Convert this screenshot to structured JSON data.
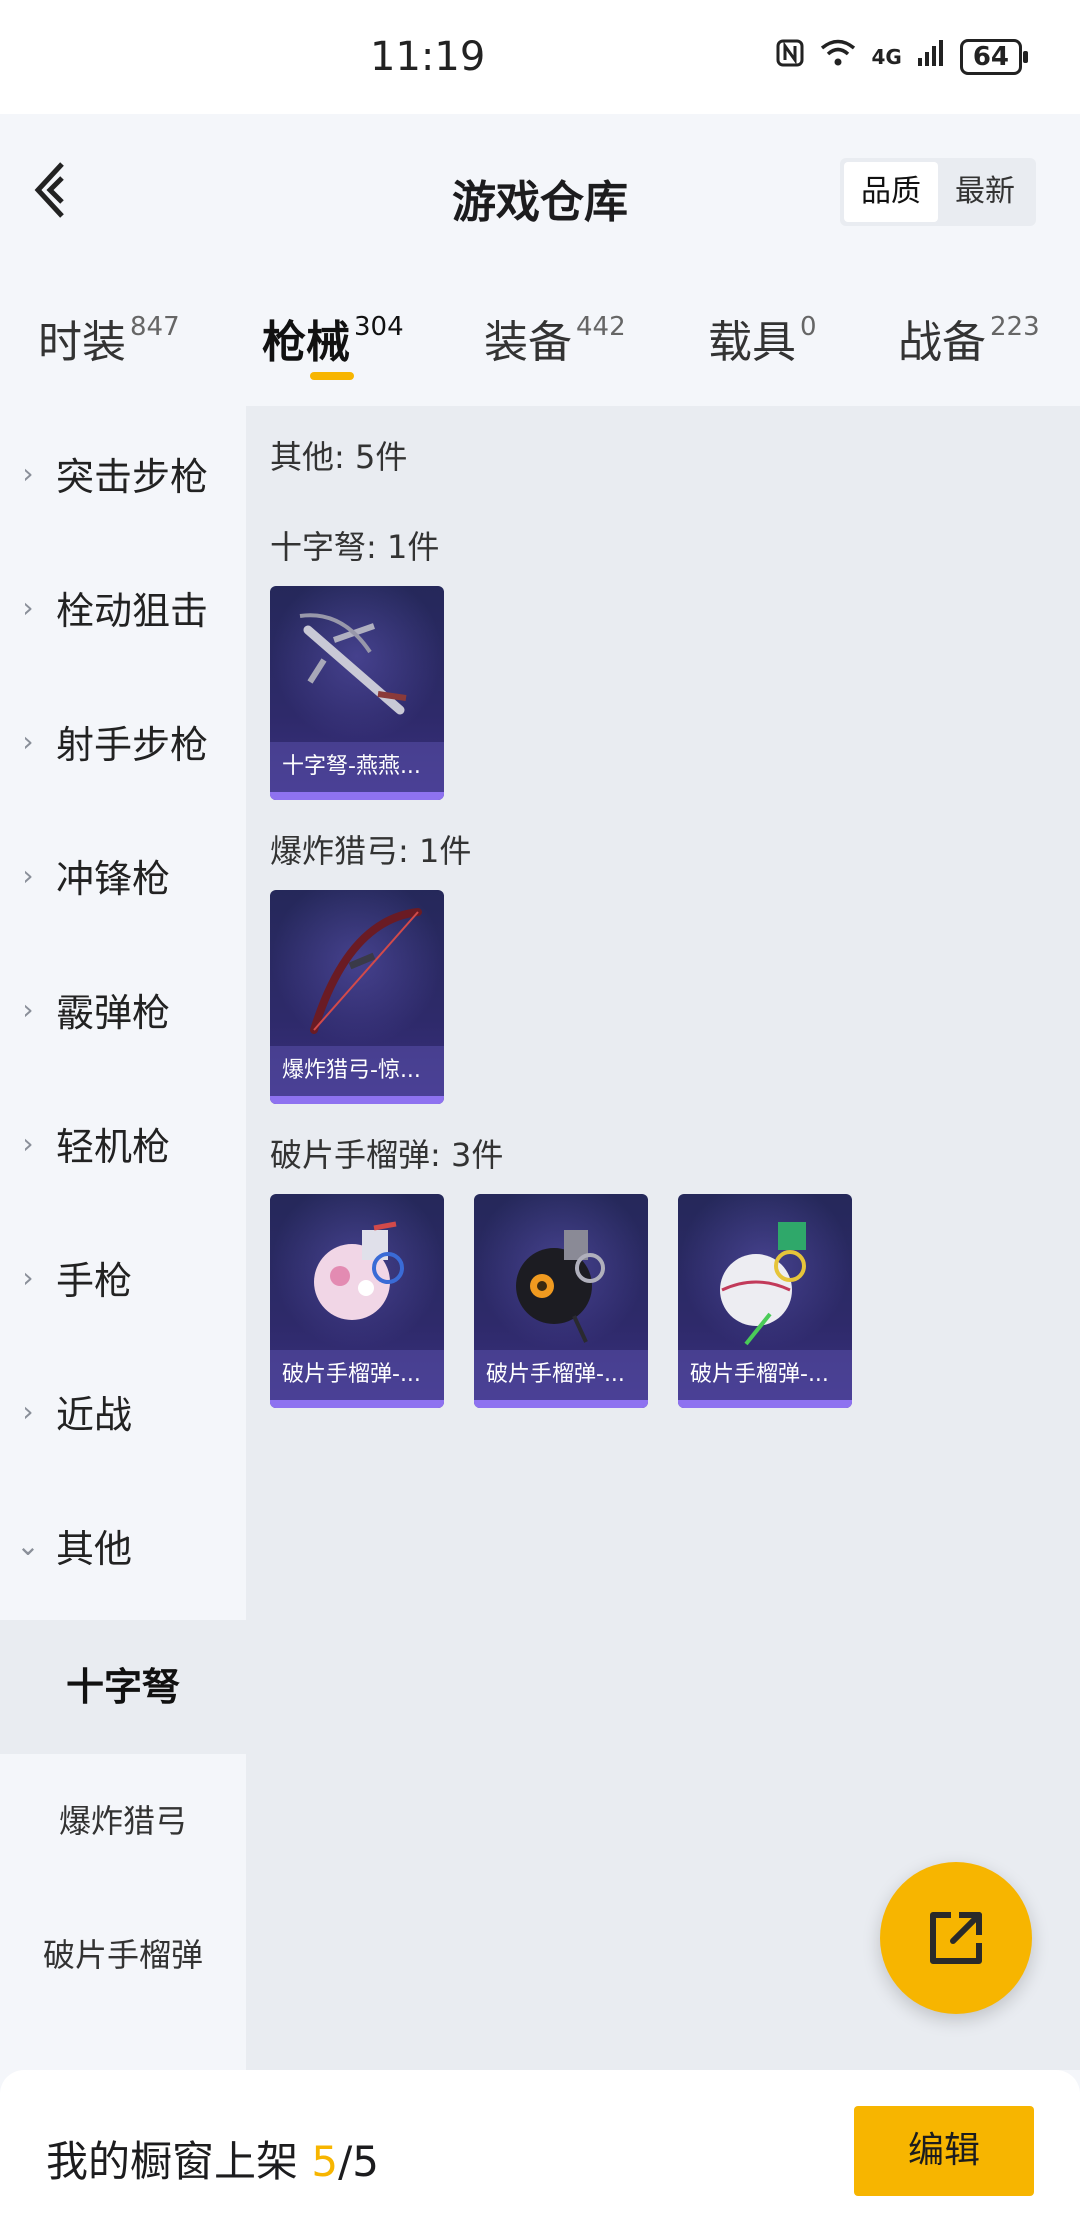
{
  "status_bar": {
    "time": "11:19",
    "network": "4G",
    "battery": "64"
  },
  "header": {
    "title": "游戏仓库",
    "back_icon": "chevron-left-icon",
    "sort_options": [
      "品质",
      "最新"
    ],
    "sort_selected": "品质"
  },
  "tabs": [
    {
      "label": "时装",
      "count": "847"
    },
    {
      "label": "枪械",
      "count": "304",
      "active": true
    },
    {
      "label": "装备",
      "count": "442"
    },
    {
      "label": "载具",
      "count": "0"
    },
    {
      "label": "战备",
      "count": "223"
    }
  ],
  "sidebar": {
    "categories": [
      "突击步枪",
      "栓动狙击",
      "射手步枪",
      "冲锋枪",
      "霰弹枪",
      "轻机枪",
      "手枪",
      "近战",
      "其他"
    ],
    "subcategories": [
      "十字弩",
      "爆炸猎弓",
      "破片手榴弹"
    ],
    "selected": "十字弩"
  },
  "content": {
    "group_header": "其他: 5件",
    "sections": [
      {
        "header": "十字弩: 1件",
        "items": [
          "十字弩-燕燕..."
        ]
      },
      {
        "header": "爆炸猎弓: 1件",
        "items": [
          "爆炸猎弓-惊..."
        ]
      },
      {
        "header": "破片手榴弹: 3件",
        "items": [
          "破片手榴弹-...",
          "破片手榴弹-...",
          "破片手榴弹-..."
        ]
      }
    ]
  },
  "fab": {
    "icon": "share-external-icon"
  },
  "bottom_bar": {
    "label": "我的橱窗上架",
    "current": "5",
    "separator": "/",
    "total": "5",
    "edit_label": "编辑"
  },
  "colors": {
    "accent": "#f7b500",
    "card_bg": "#2e2a6a",
    "card_bar": "#8e72f0"
  }
}
